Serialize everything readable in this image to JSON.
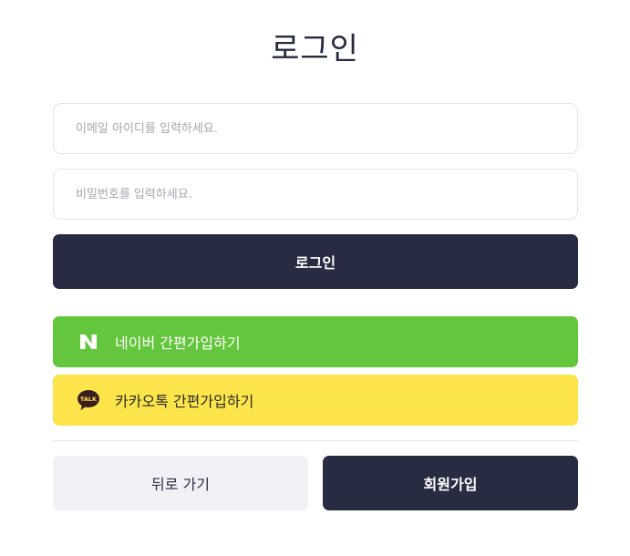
{
  "page": {
    "title": "로그인"
  },
  "form": {
    "email_placeholder": "이메일 아이디를 입력하세요.",
    "password_placeholder": "비밀번호를 입력하세요.",
    "login_label": "로그인"
  },
  "social": {
    "naver": {
      "label": "네이버 간편가입하기",
      "icon": "naver-n-icon",
      "color": "#64c63c"
    },
    "kakao": {
      "label": "카카오톡 간편가입하기",
      "icon": "kakao-talk-icon",
      "icon_text": "TALK",
      "color": "#fce54a"
    }
  },
  "footer": {
    "back_label": "뒤로 가기",
    "signup_label": "회원가입"
  },
  "colors": {
    "primary_dark": "#282c42",
    "naver_green": "#64c63c",
    "kakao_yellow": "#fce54a",
    "secondary_bg": "#f2f2f6"
  }
}
